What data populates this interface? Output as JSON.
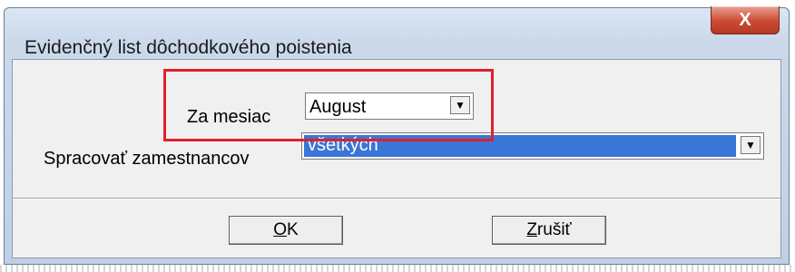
{
  "dialog": {
    "title": "Evidenčný list dôchodkového poistenia",
    "close_symbol": "X"
  },
  "form": {
    "month_label": "Za mesiac",
    "month_value": "August",
    "employees_label": "Spracovať zamestnancov",
    "employees_value": "všetkých"
  },
  "buttons": {
    "ok_mnemonic": "O",
    "ok_rest": "K",
    "cancel_mnemonic": "Z",
    "cancel_rest": "rušiť"
  },
  "icons": {
    "dropdown": "▼"
  },
  "colors": {
    "highlight": "#e0202a",
    "selection": "#3a76d8",
    "close_button": "#cc4a32"
  }
}
